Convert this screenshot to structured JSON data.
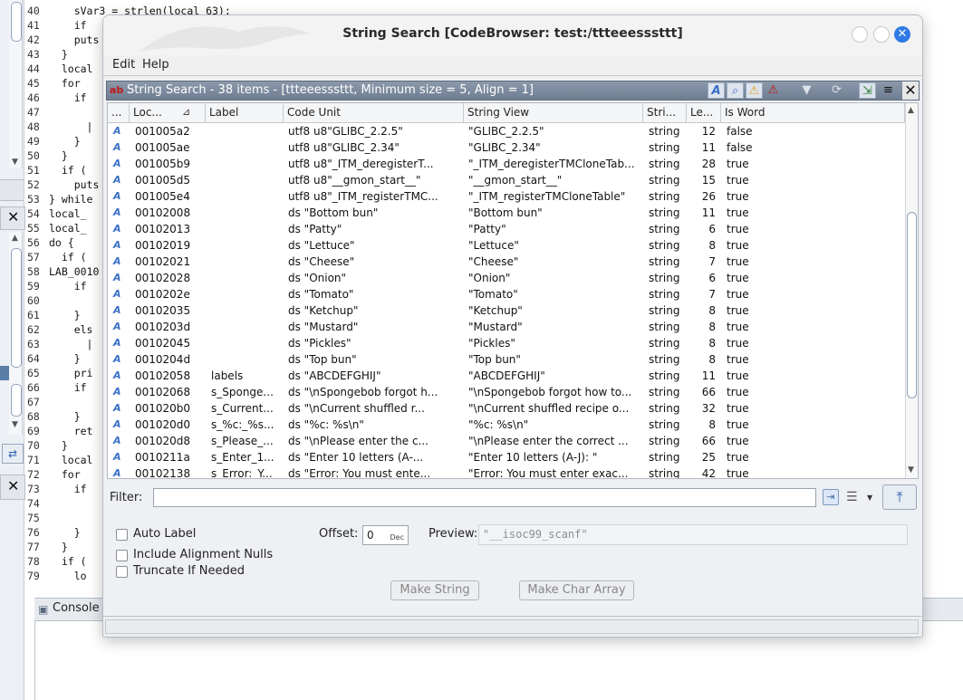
{
  "background": {
    "code_lines": [
      {
        "n": "40",
        "text": "    sVar3 = strlen(local_63);"
      },
      {
        "n": "41",
        "text": "    if"
      },
      {
        "n": "42",
        "text": "    puts"
      },
      {
        "n": "43",
        "text": "  }"
      },
      {
        "n": "44",
        "text": "  local"
      },
      {
        "n": "45",
        "text": "  for"
      },
      {
        "n": "46",
        "text": "    if"
      },
      {
        "n": "47",
        "text": ""
      },
      {
        "n": "48",
        "text": "      |"
      },
      {
        "n": "49",
        "text": "    }"
      },
      {
        "n": "50",
        "text": "  }"
      },
      {
        "n": "51",
        "text": "  if ("
      },
      {
        "n": "52",
        "text": "    puts"
      },
      {
        "n": "53",
        "text": "} while"
      },
      {
        "n": "54",
        "text": "local_"
      },
      {
        "n": "55",
        "text": "local_"
      },
      {
        "n": "56",
        "text": "do {"
      },
      {
        "n": "57",
        "text": "  if ("
      },
      {
        "n": "58",
        "text": "LAB_0010"
      },
      {
        "n": "59",
        "text": "    if"
      },
      {
        "n": "60",
        "text": ""
      },
      {
        "n": "61",
        "text": "    }"
      },
      {
        "n": "62",
        "text": "    els"
      },
      {
        "n": "63",
        "text": "      |"
      },
      {
        "n": "64",
        "text": "    }"
      },
      {
        "n": "65",
        "text": "    pri"
      },
      {
        "n": "66",
        "text": "    if"
      },
      {
        "n": "67",
        "text": ""
      },
      {
        "n": "68",
        "text": "    }"
      },
      {
        "n": "69",
        "text": "    ret"
      },
      {
        "n": "70",
        "text": "  }"
      },
      {
        "n": "71",
        "text": "  local"
      },
      {
        "n": "72",
        "text": "  for"
      },
      {
        "n": "73",
        "text": "    if"
      },
      {
        "n": "74",
        "text": ""
      },
      {
        "n": "75",
        "text": ""
      },
      {
        "n": "76",
        "text": "    }"
      },
      {
        "n": "77",
        "text": "  }"
      },
      {
        "n": "78",
        "text": "  if ("
      },
      {
        "n": "79",
        "text": "    lo"
      }
    ],
    "console_label": "Console"
  },
  "dialog": {
    "title": "String Search [CodeBrowser: test:/ttteeesssttt]",
    "menu": [
      {
        "label": "Edit",
        "mnemonic": "E"
      },
      {
        "label": "Help",
        "mnemonic": "H"
      }
    ],
    "panel_title": "String Search - 38 items - [ttteeesssttt, Minimum size = 5, Align = 1]",
    "toolbar_icons": [
      "string-type-icon",
      "search-icon",
      "warning-icon",
      "error-icon",
      "filter-icon",
      "refresh-icon",
      "navigate-icon",
      "menu-icon"
    ],
    "columns": [
      "...",
      "Loc...",
      "Label",
      "Code Unit",
      "String View",
      "Stri...",
      "Le...",
      "Is Word"
    ],
    "rows": [
      {
        "loc": "001005a2",
        "label": "",
        "code": "utf8 u8\"GLIBC_2.2.5\"",
        "view": "\"GLIBC_2.2.5\"",
        "type": "string",
        "len": "12",
        "word": "false"
      },
      {
        "loc": "001005ae",
        "label": "",
        "code": "utf8 u8\"GLIBC_2.34\"",
        "view": "\"GLIBC_2.34\"",
        "type": "string",
        "len": "11",
        "word": "false"
      },
      {
        "loc": "001005b9",
        "label": "",
        "code": "utf8 u8\"_ITM_deregisterT...",
        "view": "\"_ITM_deregisterTMCloneTab...",
        "type": "string",
        "len": "28",
        "word": "true"
      },
      {
        "loc": "001005d5",
        "label": "",
        "code": "utf8 u8\"__gmon_start__\"",
        "view": "\"__gmon_start__\"",
        "type": "string",
        "len": "15",
        "word": "true"
      },
      {
        "loc": "001005e4",
        "label": "",
        "code": "utf8 u8\"_ITM_registerTMC...",
        "view": "\"_ITM_registerTMCloneTable\"",
        "type": "string",
        "len": "26",
        "word": "true"
      },
      {
        "loc": "00102008",
        "label": "",
        "code": "ds \"Bottom bun\"",
        "view": "\"Bottom bun\"",
        "type": "string",
        "len": "11",
        "word": "true"
      },
      {
        "loc": "00102013",
        "label": "",
        "code": "ds \"Patty\"",
        "view": "\"Patty\"",
        "type": "string",
        "len": "6",
        "word": "true"
      },
      {
        "loc": "00102019",
        "label": "",
        "code": "ds \"Lettuce\"",
        "view": "\"Lettuce\"",
        "type": "string",
        "len": "8",
        "word": "true"
      },
      {
        "loc": "00102021",
        "label": "",
        "code": "ds \"Cheese\"",
        "view": "\"Cheese\"",
        "type": "string",
        "len": "7",
        "word": "true"
      },
      {
        "loc": "00102028",
        "label": "",
        "code": "ds \"Onion\"",
        "view": "\"Onion\"",
        "type": "string",
        "len": "6",
        "word": "true"
      },
      {
        "loc": "0010202e",
        "label": "",
        "code": "ds \"Tomato\"",
        "view": "\"Tomato\"",
        "type": "string",
        "len": "7",
        "word": "true"
      },
      {
        "loc": "00102035",
        "label": "",
        "code": "ds \"Ketchup\"",
        "view": "\"Ketchup\"",
        "type": "string",
        "len": "8",
        "word": "true"
      },
      {
        "loc": "0010203d",
        "label": "",
        "code": "ds \"Mustard\"",
        "view": "\"Mustard\"",
        "type": "string",
        "len": "8",
        "word": "true"
      },
      {
        "loc": "00102045",
        "label": "",
        "code": "ds \"Pickles\"",
        "view": "\"Pickles\"",
        "type": "string",
        "len": "8",
        "word": "true"
      },
      {
        "loc": "0010204d",
        "label": "",
        "code": "ds \"Top bun\"",
        "view": "\"Top bun\"",
        "type": "string",
        "len": "8",
        "word": "true"
      },
      {
        "loc": "00102058",
        "label": "labels",
        "code": "ds \"ABCDEFGHIJ\"",
        "view": "\"ABCDEFGHIJ\"",
        "type": "string",
        "len": "11",
        "word": "true"
      },
      {
        "loc": "00102068",
        "label": "s_Sponge...",
        "code": "ds \"\\nSpongebob forgot h...",
        "view": "\"\\nSpongebob forgot how to...",
        "type": "string",
        "len": "66",
        "word": "true"
      },
      {
        "loc": "001020b0",
        "label": "s_Current...",
        "code": "ds \"\\nCurrent shuffled r...",
        "view": "\"\\nCurrent shuffled recipe o...",
        "type": "string",
        "len": "32",
        "word": "true"
      },
      {
        "loc": "001020d0",
        "label": "s_%c:_%s...",
        "code": "ds \"%c: %s\\n\"",
        "view": "\"%c: %s\\n\"",
        "type": "string",
        "len": "8",
        "word": "true"
      },
      {
        "loc": "001020d8",
        "label": "s_Please_...",
        "code": "ds \"\\nPlease enter the c...",
        "view": "\"\\nPlease enter the correct ...",
        "type": "string",
        "len": "66",
        "word": "true"
      },
      {
        "loc": "0010211a",
        "label": "s_Enter_1...",
        "code": "ds \"Enter 10 letters (A-...",
        "view": "\"Enter 10 letters (A-J): \"",
        "type": "string",
        "len": "25",
        "word": "true"
      },
      {
        "loc": "00102138",
        "label": "s_Error:_Y...",
        "code": "ds \"Error: You must ente...",
        "view": "\"Error: You must enter exac...",
        "type": "string",
        "len": "42",
        "word": "true"
      }
    ],
    "filter": {
      "label": "Filter:",
      "value": ""
    },
    "options": {
      "auto_label": "Auto Label",
      "include_alignment_nulls": "Include Alignment Nulls",
      "truncate_if_needed": "Truncate If Needed",
      "offset_label": "Offset:",
      "offset_value": "0",
      "offset_unit": "Dec",
      "preview_label": "Preview:",
      "preview_value": "\"__isoc99_scanf\""
    },
    "buttons": {
      "make_string": "Make String",
      "make_char_array": "Make Char Array"
    }
  }
}
